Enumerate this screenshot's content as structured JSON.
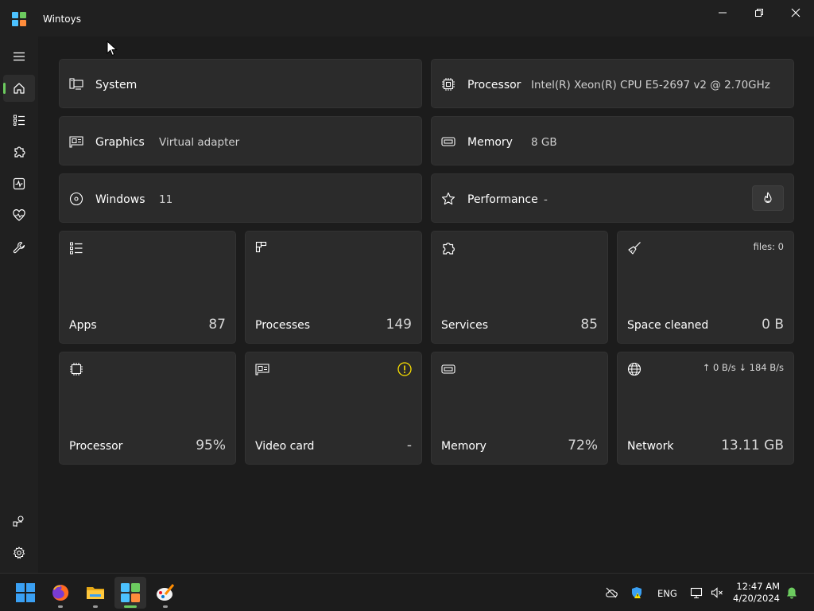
{
  "window": {
    "title": "Wintoys"
  },
  "info": {
    "system": {
      "label": "System",
      "value": ""
    },
    "processor": {
      "label": "Processor",
      "value": "Intel(R) Xeon(R) CPU E5-2697 v2 @ 2.70GHz"
    },
    "graphics": {
      "label": "Graphics",
      "value": "Virtual adapter"
    },
    "memory": {
      "label": "Memory",
      "value": "8 GB"
    },
    "windows": {
      "label": "Windows",
      "value": "11"
    },
    "performance": {
      "label": "Performance",
      "value": "-"
    }
  },
  "tiles": {
    "apps": {
      "label": "Apps",
      "value": "87"
    },
    "processes": {
      "label": "Processes",
      "value": "149"
    },
    "services": {
      "label": "Services",
      "value": "85"
    },
    "space": {
      "label": "Space cleaned",
      "value": "0 B",
      "extra": "files: 0"
    },
    "processor": {
      "label": "Processor",
      "value": "95%"
    },
    "videocard": {
      "label": "Video card",
      "value": "-"
    },
    "memory": {
      "label": "Memory",
      "value": "72%"
    },
    "network": {
      "label": "Network",
      "value": "13.11 GB",
      "extra": "↑ 0 B/s  ↓ 184 B/s"
    }
  },
  "taskbar": {
    "language": "ENG",
    "time": "12:47 AM",
    "date": "4/20/2024"
  },
  "colors": {
    "accent": "#6ccb5f",
    "warning": "#fce100",
    "card": "#2b2b2b",
    "background": "#1c1c1c"
  }
}
